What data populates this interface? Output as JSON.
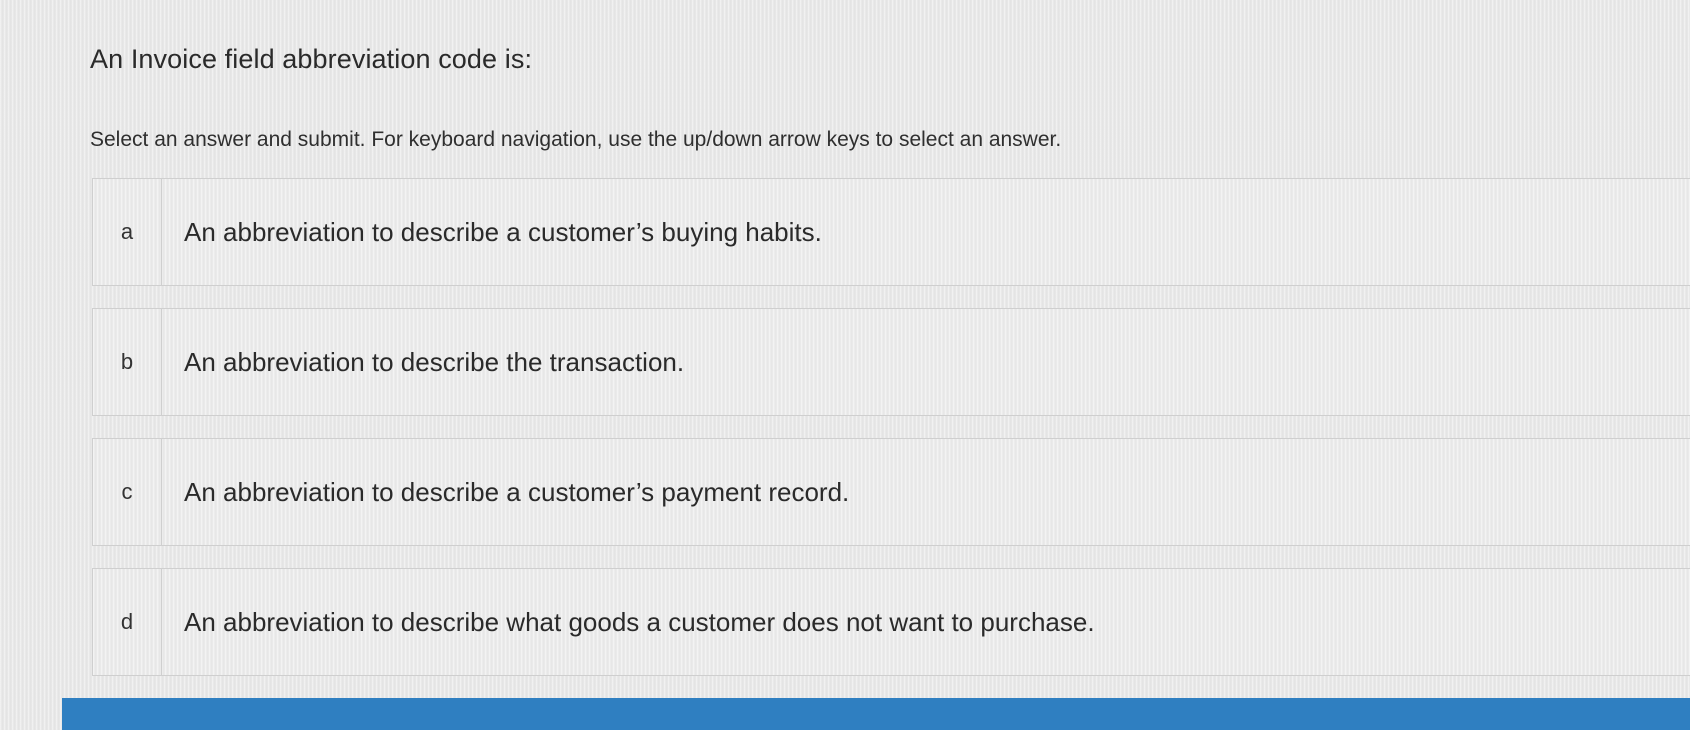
{
  "question": {
    "title": "An Invoice field abbreviation code is:",
    "instructions": "Select an answer and submit. For keyboard navigation, use the up/down arrow keys to select an answer."
  },
  "answers": [
    {
      "letter": "a",
      "text": "An abbreviation to describe a customer’s buying habits."
    },
    {
      "letter": "b",
      "text": "An abbreviation to describe the transaction."
    },
    {
      "letter": "c",
      "text": "An abbreviation to describe a customer’s payment record."
    },
    {
      "letter": "d",
      "text": "An abbreviation to describe what goods a customer does not want to purchase."
    }
  ],
  "colors": {
    "background": "#e9e9e9",
    "border": "#cfcfcf",
    "submit_bar": "#2f7fc1"
  }
}
